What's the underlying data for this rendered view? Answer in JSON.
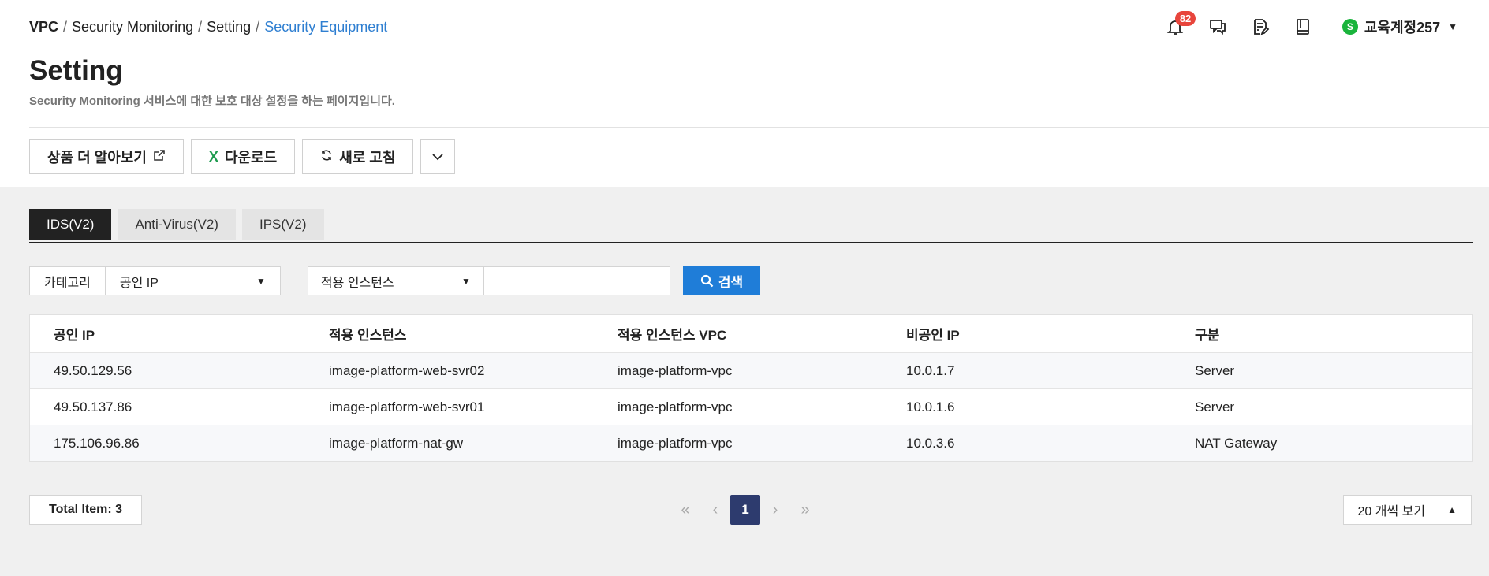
{
  "breadcrumb": {
    "root": "VPC",
    "item1": "Security Monitoring",
    "item2": "Setting",
    "current": "Security Equipment"
  },
  "header": {
    "notification_count": "82",
    "user_initial": "S",
    "user_name": "교육계정257"
  },
  "page": {
    "title": "Setting",
    "description": "Security Monitoring 서비스에 대한 보호 대상 설정을 하는 페이지입니다."
  },
  "actions": {
    "learn_more": "상품 더 알아보기",
    "download": "다운로드",
    "download_icon_text": "X",
    "refresh": "새로 고침"
  },
  "tabs": [
    {
      "label": "IDS(V2)",
      "active": true
    },
    {
      "label": "Anti-Virus(V2)",
      "active": false
    },
    {
      "label": "IPS(V2)",
      "active": false
    }
  ],
  "filters": {
    "category_label": "카테고리",
    "category_value": "공인 IP",
    "instance_select": "적용 인스턴스",
    "search_value": "",
    "search_button": "검색"
  },
  "table": {
    "headers": [
      "공인 IP",
      "적용 인스턴스",
      "적용 인스턴스 VPC",
      "비공인 IP",
      "구분"
    ],
    "rows": [
      [
        "49.50.129.56",
        "image-platform-web-svr02",
        "image-platform-vpc",
        "10.0.1.7",
        "Server"
      ],
      [
        "49.50.137.86",
        "image-platform-web-svr01",
        "image-platform-vpc",
        "10.0.1.6",
        "Server"
      ],
      [
        "175.106.96.86",
        "image-platform-nat-gw",
        "image-platform-vpc",
        "10.0.3.6",
        "NAT Gateway"
      ]
    ]
  },
  "footer": {
    "total": "Total Item: 3",
    "current_page": "1",
    "page_size": "20 개씩 보기"
  },
  "colors": {
    "accent": "#1f7dd8",
    "breadcrumb_current": "#2f7fd1",
    "badge": "#e8453c",
    "page_active": "#2d3b6e",
    "excel": "#1e9b4f"
  }
}
